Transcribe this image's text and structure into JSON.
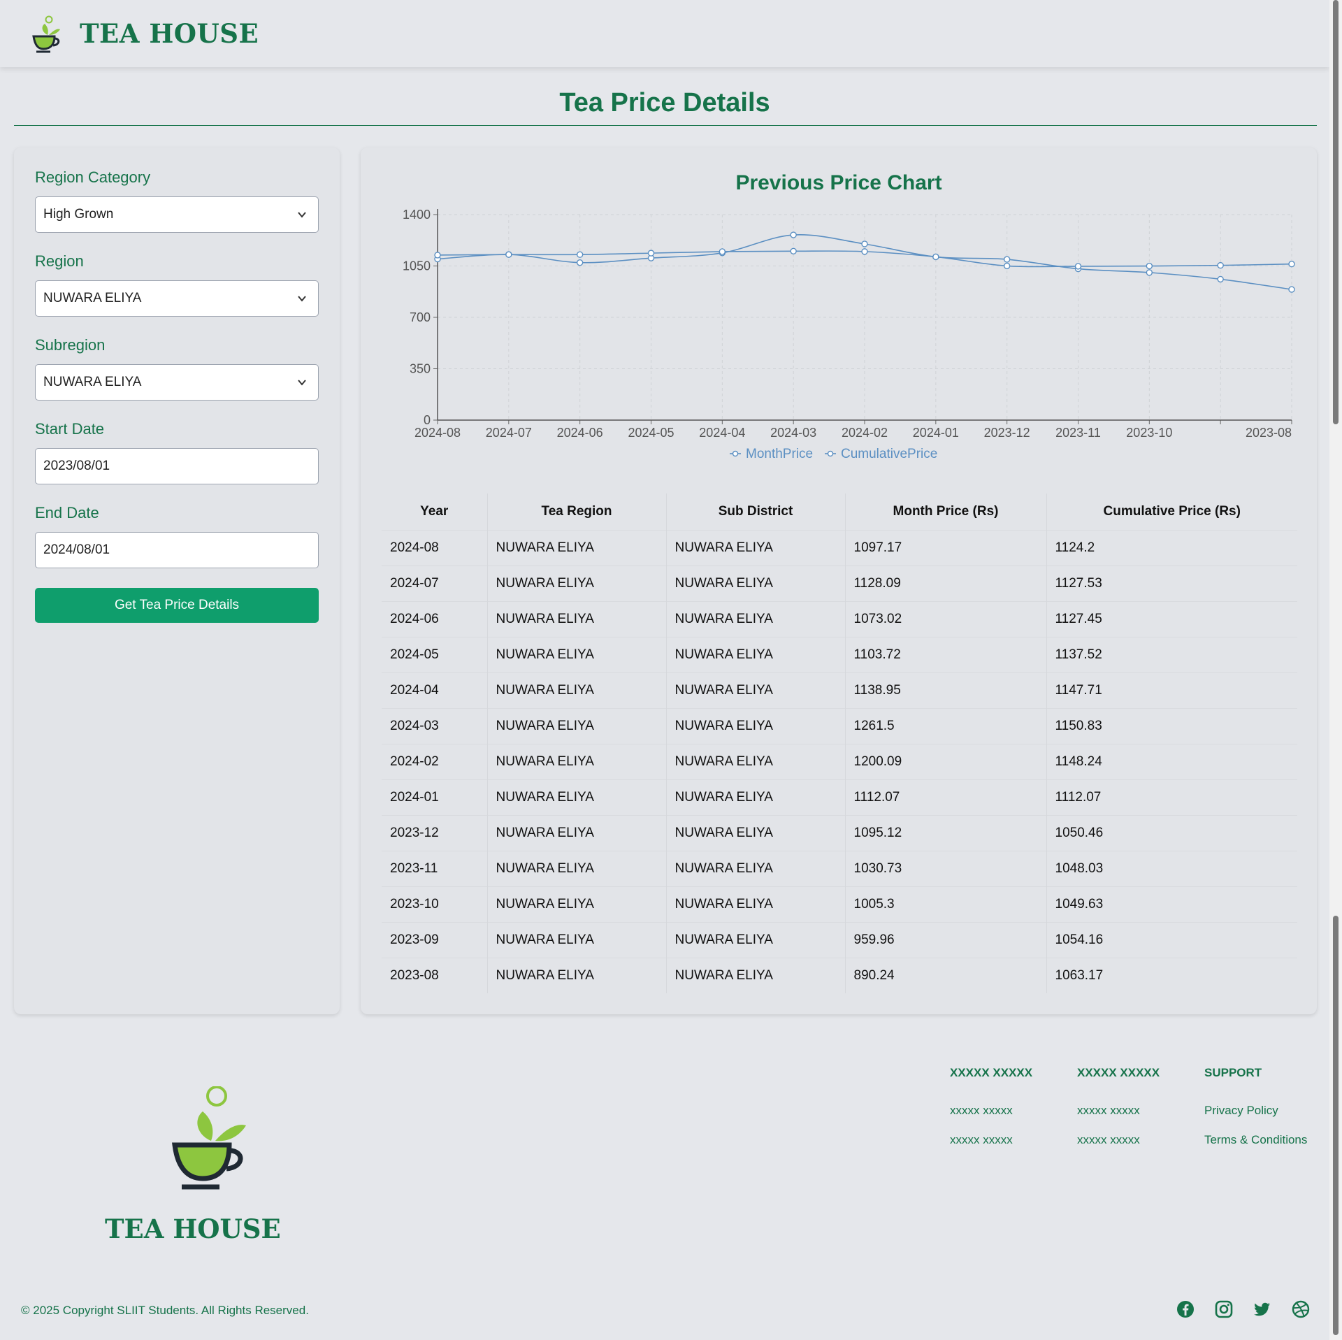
{
  "header": {
    "brand": "TEA HOUSE"
  },
  "page": {
    "title": "Tea Price Details"
  },
  "form": {
    "region_category": {
      "label": "Region Category",
      "value": "High Grown"
    },
    "region": {
      "label": "Region",
      "value": "NUWARA ELIYA"
    },
    "subregion": {
      "label": "Subregion",
      "value": "NUWARA ELIYA"
    },
    "start_date": {
      "label": "Start Date",
      "value": "2023/08/01"
    },
    "end_date": {
      "label": "End Date",
      "value": "2024/08/01"
    },
    "submit_label": "Get Tea Price Details"
  },
  "chart_data": {
    "type": "line",
    "title": "Previous Price Chart",
    "categories": [
      "2024-08",
      "2024-07",
      "2024-06",
      "2024-05",
      "2024-04",
      "2024-03",
      "2024-02",
      "2024-01",
      "2023-12",
      "2023-11",
      "2023-10",
      "2023-09",
      "2023-08"
    ],
    "x_tick_labels": [
      "2024-08",
      "2024-07",
      "2024-06",
      "2024-05",
      "2024-04",
      "2024-03",
      "2024-02",
      "2024-01",
      "2023-12",
      "2023-11",
      "2023-10",
      "",
      "2023-08"
    ],
    "series": [
      {
        "name": "MonthPrice",
        "values": [
          1097.17,
          1128.09,
          1073.02,
          1103.72,
          1138.95,
          1261.5,
          1200.09,
          1112.07,
          1095.12,
          1030.73,
          1005.3,
          959.96,
          890.24
        ]
      },
      {
        "name": "CumulativePrice",
        "values": [
          1124.2,
          1127.53,
          1127.45,
          1137.52,
          1147.71,
          1150.83,
          1148.24,
          1112.07,
          1050.46,
          1048.03,
          1049.63,
          1054.16,
          1063.17
        ]
      }
    ],
    "y_ticks": [
      0,
      350,
      700,
      1050,
      1400
    ],
    "ylim": [
      0,
      1400
    ],
    "grid": true,
    "legend_position": "bottom",
    "line_color": "#5b8fc2"
  },
  "table": {
    "headers": [
      "Year",
      "Tea Region",
      "Sub District",
      "Month Price (Rs)",
      "Cumulative Price (Rs)"
    ],
    "rows": [
      [
        "2024-08",
        "NUWARA ELIYA",
        "NUWARA ELIYA",
        "1097.17",
        "1124.2"
      ],
      [
        "2024-07",
        "NUWARA ELIYA",
        "NUWARA ELIYA",
        "1128.09",
        "1127.53"
      ],
      [
        "2024-06",
        "NUWARA ELIYA",
        "NUWARA ELIYA",
        "1073.02",
        "1127.45"
      ],
      [
        "2024-05",
        "NUWARA ELIYA",
        "NUWARA ELIYA",
        "1103.72",
        "1137.52"
      ],
      [
        "2024-04",
        "NUWARA ELIYA",
        "NUWARA ELIYA",
        "1138.95",
        "1147.71"
      ],
      [
        "2024-03",
        "NUWARA ELIYA",
        "NUWARA ELIYA",
        "1261.5",
        "1150.83"
      ],
      [
        "2024-02",
        "NUWARA ELIYA",
        "NUWARA ELIYA",
        "1200.09",
        "1148.24"
      ],
      [
        "2024-01",
        "NUWARA ELIYA",
        "NUWARA ELIYA",
        "1112.07",
        "1112.07"
      ],
      [
        "2023-12",
        "NUWARA ELIYA",
        "NUWARA ELIYA",
        "1095.12",
        "1050.46"
      ],
      [
        "2023-11",
        "NUWARA ELIYA",
        "NUWARA ELIYA",
        "1030.73",
        "1048.03"
      ],
      [
        "2023-10",
        "NUWARA ELIYA",
        "NUWARA ELIYA",
        "1005.3",
        "1049.63"
      ],
      [
        "2023-09",
        "NUWARA ELIYA",
        "NUWARA ELIYA",
        "959.96",
        "1054.16"
      ],
      [
        "2023-08",
        "NUWARA ELIYA",
        "NUWARA ELIYA",
        "890.24",
        "1063.17"
      ]
    ]
  },
  "footer": {
    "brand": "TEA HOUSE",
    "columns": [
      {
        "heading": "XXXXX XXXXX",
        "links": [
          "xxxxx xxxxx",
          "xxxxx xxxxx"
        ]
      },
      {
        "heading": "XXXXX XXXXX",
        "links": [
          "xxxxx xxxxx",
          "xxxxx xxxxx"
        ]
      },
      {
        "heading": "SUPPORT",
        "links": [
          "Privacy Policy",
          "Terms & Conditions"
        ]
      }
    ],
    "copyright": "© 2025 Copyright SLIIT Students. All Rights Reserved.",
    "socials": [
      "facebook-icon",
      "instagram-icon",
      "twitter-icon",
      "dribbble-icon"
    ]
  },
  "colors": {
    "brand_green": "#16734a",
    "button_green": "#0f9e6c",
    "chart_line": "#5b8fc2"
  }
}
